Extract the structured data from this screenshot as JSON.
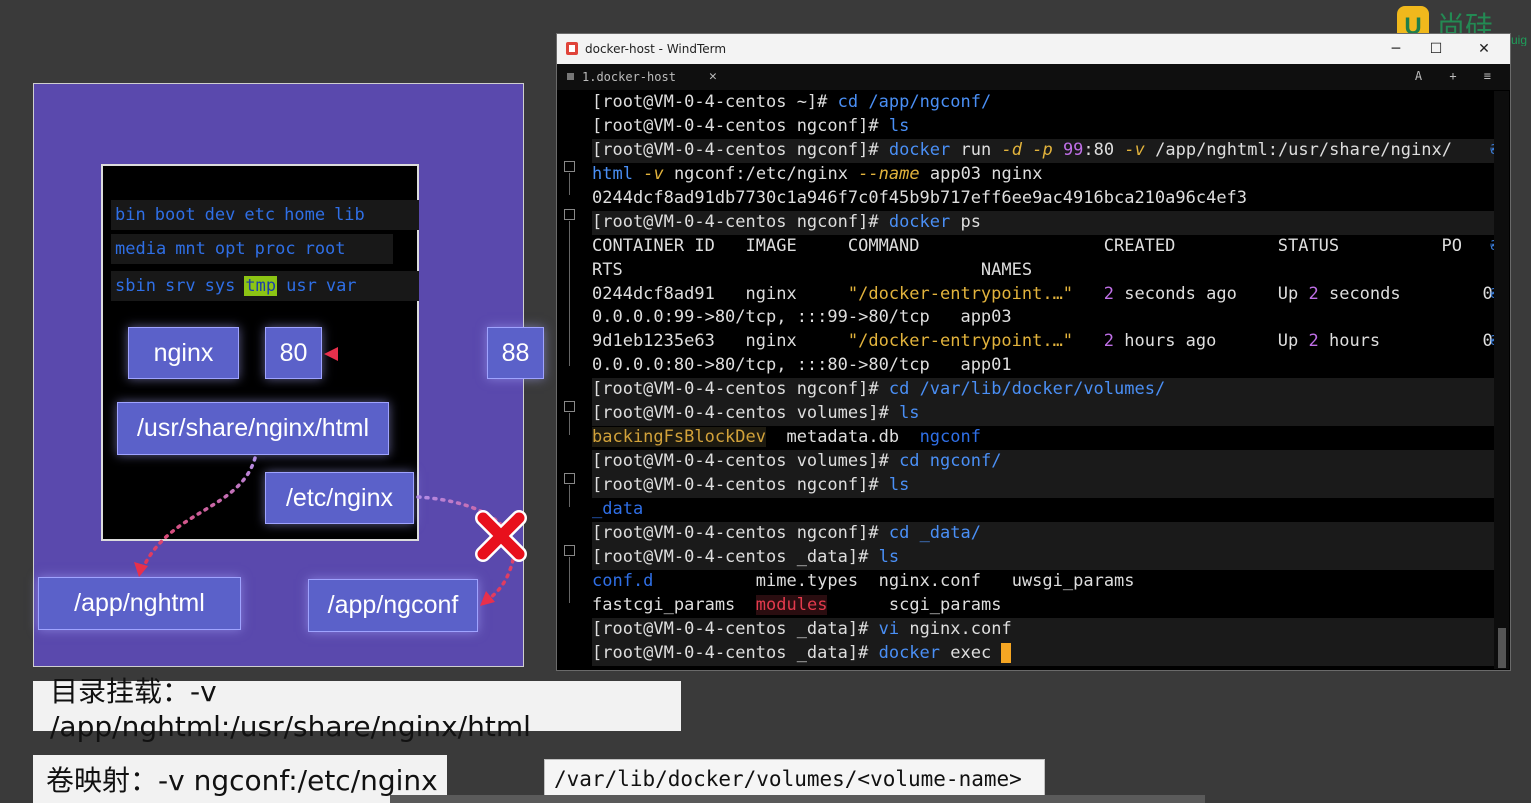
{
  "logo": {
    "text": "尚硅",
    "sub": "uig"
  },
  "diagram": {
    "dir_rows": [
      [
        "bin",
        "boot",
        "dev",
        "etc",
        "home",
        "lib"
      ],
      [
        "media",
        "mnt",
        "opt",
        "proc",
        "root"
      ],
      [
        "sbin",
        "srv",
        "sys",
        "tmp",
        "usr",
        "var"
      ]
    ],
    "highlighted_dir": "tmp",
    "nginx_label": "nginx",
    "container_port": "80",
    "host_port": "88",
    "container_html_path": "/usr/share/nginx/html",
    "container_conf_path": "/etc/nginx",
    "host_html_path": "/app/nghtml",
    "host_conf_path": "/app/ngconf"
  },
  "captions": {
    "bind_mount": "目录挂载：-v /app/nghtml:/usr/share/nginx/html",
    "volume_map": "卷映射：-v ngconf:/etc/nginx",
    "volume_path": "/var/lib/docker/volumes/<volume-name>"
  },
  "window": {
    "title": "docker-host - WindTerm",
    "minimize": "─",
    "maximize": "☐",
    "close": "✕",
    "tab_label": "1.docker-host",
    "tab_close": "✕",
    "tab_tools": "A + ≡"
  },
  "terminal": {
    "prompt_home": "[root@VM-0-4-centos ~]#",
    "prompt_ngconf": "[root@VM-0-4-centos ngconf]#",
    "prompt_volumes": "[root@VM-0-4-centos volumes]#",
    "prompt_data": "[root@VM-0-4-centos _data]#",
    "l1_cmd": "cd",
    "l1_arg": "/app/ngconf/",
    "ls": "ls",
    "docker": "docker",
    "run": "run",
    "opt_d": "-d",
    "opt_p": "-p",
    "port_map_a": "99",
    "port_map_b": ":80",
    "opt_v": "-v",
    "vol1": "/app/nghtml:/usr/share/nginx/",
    "vol1_cont": "html",
    "vol2": "ngconf:/etc/nginx",
    "opt_name": "--name",
    "name_val": "app03 nginx",
    "container_hash": "0244dcf8ad91db7730c1a946f7c0f45b9b717eff6ee9ac4916bca210a96c4ef3",
    "ps": "ps",
    "ps_header_1": "CONTAINER ID   IMAGE     COMMAND                  CREATED          STATUS          PO",
    "ps_header_2": "RTS                                   NAMES",
    "r1_id": "0244dcf8ad91   nginx     ",
    "r1_cmd": "\"/docker-entrypoint.…\"",
    "r1_created_n": "2",
    "r1_created": " seconds ago    Up ",
    "r1_up_n": "2",
    "r1_up": " seconds        0.",
    "r1_ports": "0.0.0.0:99->80/tcp, :::99->80/tcp   app03",
    "r2_id": "9d1eb1235e63   nginx     ",
    "r2_cmd": "\"/docker-entrypoint.…\"",
    "r2_created_n": "2",
    "r2_created": " hours ago      Up ",
    "r2_up_n": "2",
    "r2_up": " hours          0.",
    "r2_ports": "0.0.0.0:80->80/tcp, :::80->80/tcp   app01",
    "cd": "cd",
    "volumes_path": "/var/lib/docker/volumes/",
    "ls_backing": "backingFsBlockDev",
    "ls_meta": "metadata.db",
    "ls_ngconf": "ngconf",
    "cd_ngconf": "ngconf/",
    "ls_data": "_data",
    "cd_data": "_data/",
    "f_confd": "conf.d",
    "f_mime": "mime.types",
    "f_nginxconf": "nginx.conf",
    "f_uwsgi": "uwsgi_params",
    "f_fastcgi": "fastcgi_params",
    "f_modules": "modules",
    "f_scgi": "scgi_params",
    "vi": "vi",
    "vi_arg": "nginx.conf",
    "exec": "exec",
    "wrap_marker": "₴"
  },
  "colors": {
    "diagram_bg": "#5a49ad",
    "box_blue": "#5b61c9",
    "command_blue": "#4a8ff5",
    "option_yellow": "#e2b33c",
    "number_purple": "#bf6fe6",
    "cursor_orange": "#f5a623",
    "x_red": "#e8101c",
    "arrow_red": "#e8304c"
  }
}
